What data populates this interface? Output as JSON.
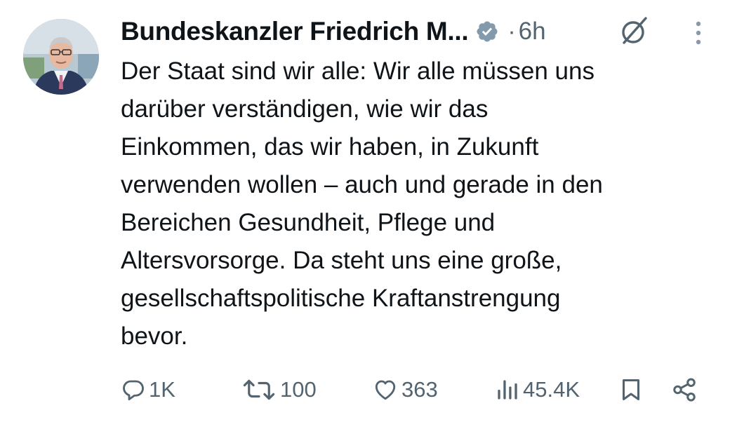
{
  "tweet": {
    "author_name": "Bundeskanzler Friedrich M...",
    "separator": "·",
    "time": "6h",
    "text": "Der Staat sind wir alle: Wir alle müssen uns\ndarüber verständigen, wie wir das\nEinkommen, das wir haben, in Zukunft\nverwenden wollen – auch und gerade in den\nBereichen Gesundheit, Pflege und\nAltersvorsorge. Da steht uns eine große,\ngesellschaftspolitische Kraftanstrengung\nbevor."
  },
  "actions": {
    "replies": "1K",
    "retweets": "100",
    "likes": "363",
    "views": "45.4K"
  },
  "colors": {
    "text": "#0f1419",
    "muted": "#536471",
    "verified_badge": "#829aab"
  },
  "icons": {
    "verified": "verified-badge-icon",
    "grok": "grok-icon",
    "more": "more-vertical-icon",
    "reply": "reply-icon",
    "retweet": "retweet-icon",
    "like": "heart-icon",
    "views": "views-chart-icon",
    "bookmark": "bookmark-icon",
    "share": "share-icon"
  }
}
